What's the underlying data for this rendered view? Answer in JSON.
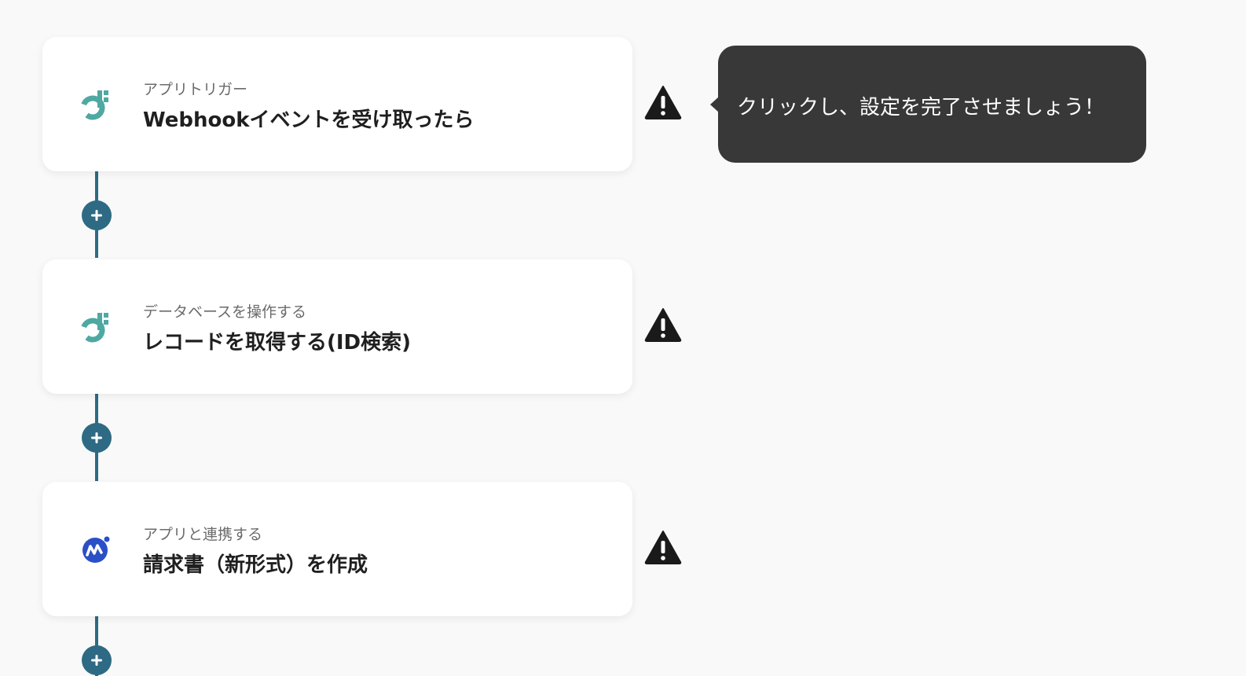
{
  "tooltip": {
    "text": "クリックし、設定を完了させましょう！"
  },
  "steps": [
    {
      "subtitle": "アプリトリガー",
      "title": "Webhookイベントを受け取ったら",
      "icon": "yoom-database-icon",
      "status_icon": "warning-icon"
    },
    {
      "subtitle": "データベースを操作する",
      "title": "レコードを取得する(ID検索)",
      "icon": "yoom-database-icon",
      "status_icon": "warning-icon"
    },
    {
      "subtitle": "アプリと連携する",
      "title": "請求書（新形式）を作成",
      "icon": "money-forward-icon",
      "status_icon": "warning-icon"
    }
  ],
  "add_button_icon": "plus-icon",
  "colors": {
    "connector": "#2e6a84",
    "teal_icon": "#4fa8a2",
    "mf_blue": "#2b4fc7",
    "tooltip_bg": "#383838",
    "warning": "#1a1a1a"
  }
}
